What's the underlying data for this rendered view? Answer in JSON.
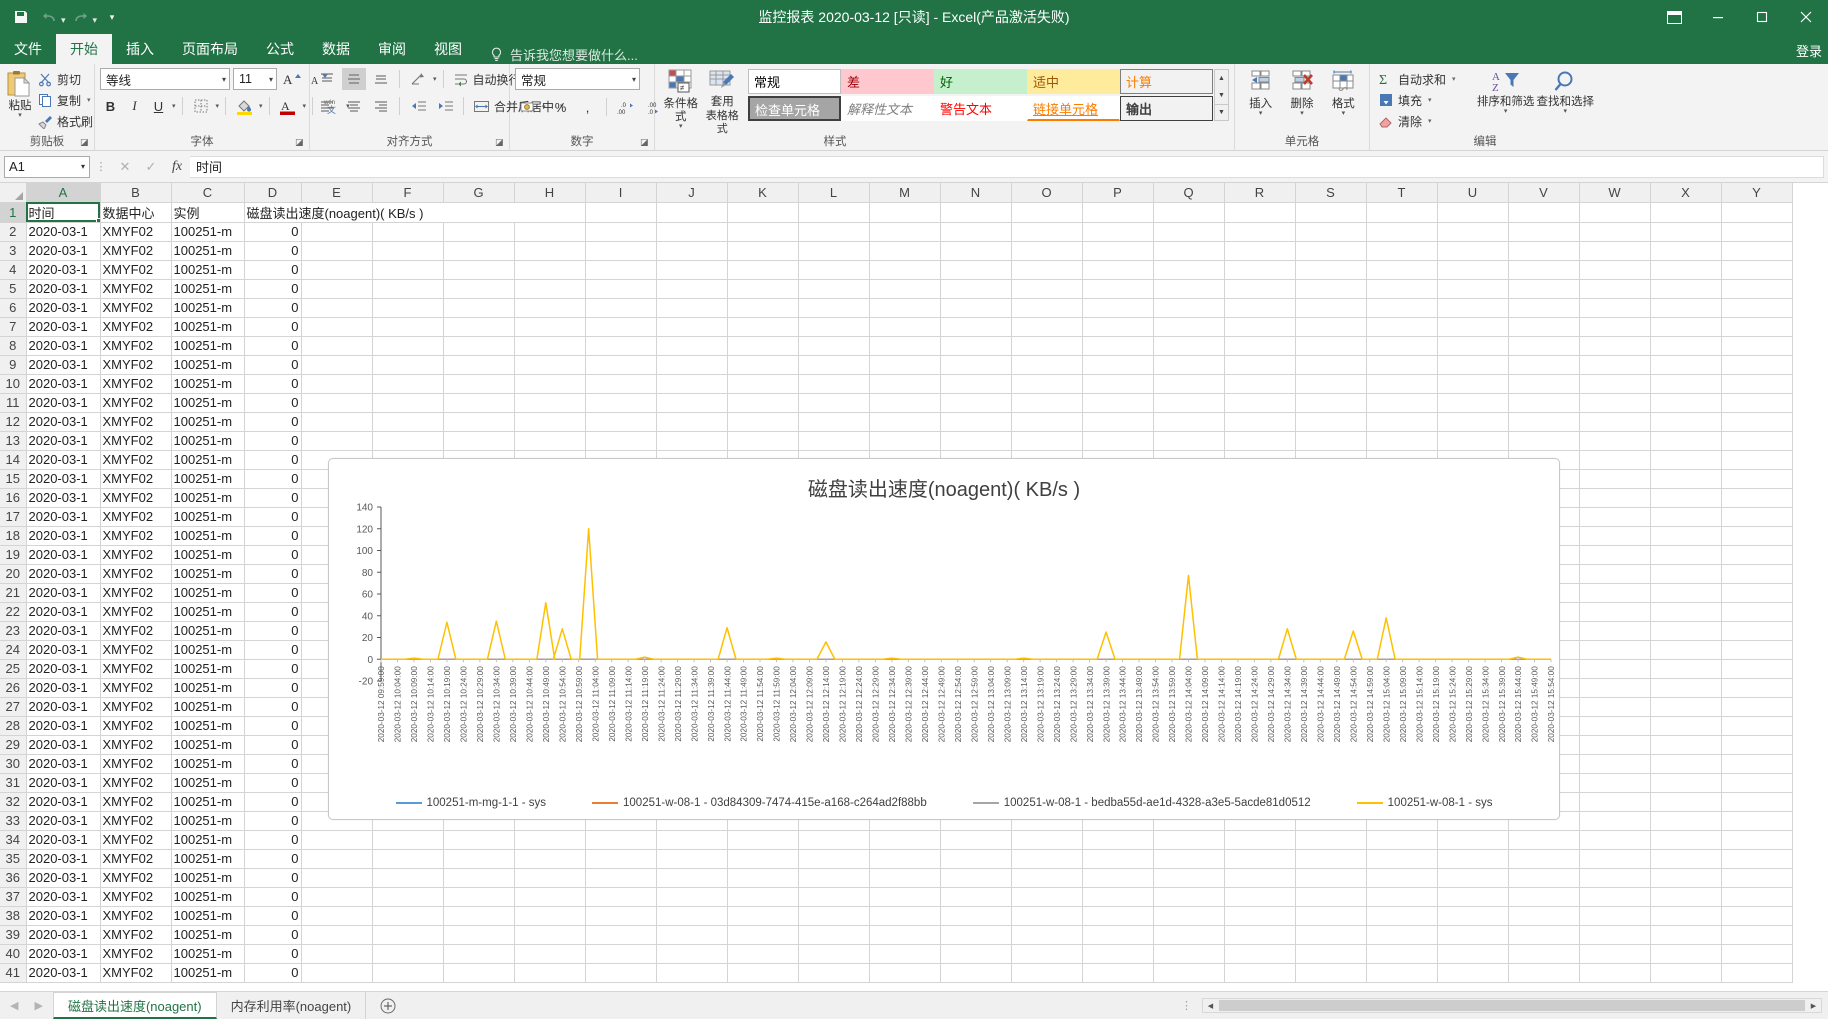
{
  "window": {
    "title": "监控报表 2020-03-12  [只读] - Excel(产品激活失败)",
    "signin": "登录",
    "minimize": "minimize",
    "restore": "restore",
    "close": "close",
    "ribbon_display_options": "ribbon-display-options"
  },
  "quick_access": {
    "save": "保存",
    "undo": "撤销",
    "redo": "恢复",
    "customize": "自定义快速访问工具栏"
  },
  "tabs": [
    {
      "label": "文件",
      "active": false
    },
    {
      "label": "开始",
      "active": true
    },
    {
      "label": "插入",
      "active": false
    },
    {
      "label": "页面布局",
      "active": false
    },
    {
      "label": "公式",
      "active": false
    },
    {
      "label": "数据",
      "active": false
    },
    {
      "label": "审阅",
      "active": false
    },
    {
      "label": "视图",
      "active": false
    }
  ],
  "tellme": "告诉我您想要做什么...",
  "ribbon": {
    "clipboard": {
      "label": "剪贴板",
      "paste": "粘贴",
      "cut": "剪切",
      "copy": "复制",
      "format_painter": "格式刷"
    },
    "font": {
      "label": "字体",
      "font_name": "等线",
      "font_size": "11",
      "grow": "A",
      "shrink": "A",
      "bold": "B",
      "italic": "I",
      "underline": "U",
      "border": "borders",
      "fill": "fill-color",
      "font_color": "font-color",
      "phonetic": "拼音"
    },
    "alignment": {
      "label": "对齐方式",
      "wrap_text": "自动换行",
      "merge_center": "合并后居中",
      "orientation": "方向",
      "align_left": "左对齐",
      "align_center": "居中",
      "align_right": "右对齐",
      "top": "顶端对齐",
      "middle": "垂直居中",
      "bottom": "底端对齐",
      "decrease_indent": "减少缩进量",
      "increase_indent": "增加缩进量"
    },
    "number": {
      "label": "数字",
      "format": "常规",
      "currency": "会计数字格式",
      "percent": "%",
      "comma": ",",
      "increase_decimal": "增加小数位数",
      "decrease_decimal": "减少小数位数"
    },
    "styles": {
      "label": "样式",
      "conditional": "条件格式",
      "table_format_l1": "套用",
      "table_format_l2": "表格格式",
      "cells": [
        {
          "text": "常规",
          "fg": "#000000",
          "bg": "#ffffff",
          "border": "#d6d6d6",
          "style": "normal",
          "selected": false
        },
        {
          "text": "差",
          "fg": "#9c0006",
          "bg": "#ffc7ce",
          "border": "#ffc7ce",
          "style": "normal",
          "selected": false
        },
        {
          "text": "好",
          "fg": "#006100",
          "bg": "#c6efce",
          "border": "#c6efce",
          "style": "normal",
          "selected": false
        },
        {
          "text": "适中",
          "fg": "#9c5700",
          "bg": "#ffeb9c",
          "border": "#ffeb9c",
          "style": "normal",
          "selected": false
        },
        {
          "text": "计算",
          "fg": "#fa7d00",
          "bg": "#f2f2f2",
          "border": "#7f7f7f",
          "style": "normal",
          "selected": false
        },
        {
          "text": "检查单元格",
          "fg": "#ffffff",
          "bg": "#a5a5a5",
          "border": "#3f3f3f",
          "style": "normal",
          "selected": true
        },
        {
          "text": "解释性文本",
          "fg": "#7f7f7f",
          "bg": "#ffffff",
          "border": "#ffffff",
          "style": "italic",
          "selected": false
        },
        {
          "text": "警告文本",
          "fg": "#ff0000",
          "bg": "#ffffff",
          "border": "#ffffff",
          "style": "normal",
          "selected": false
        },
        {
          "text": "链接单元格",
          "fg": "#fa7d00",
          "bg": "#ffffff",
          "border": "#ffffff",
          "style": "underline",
          "selected": false
        },
        {
          "text": "输出",
          "fg": "#3f3f3f",
          "bg": "#f2f2f2",
          "border": "#3f3f3f",
          "style": "bold",
          "selected": false
        }
      ],
      "scroll_up": "▲",
      "scroll_down": "▼",
      "scroll_more": "▼"
    },
    "cells": {
      "label": "单元格",
      "insert": "插入",
      "delete": "删除",
      "format": "格式"
    },
    "editing": {
      "label": "编辑",
      "autosum": "自动求和",
      "fill": "填充",
      "clear": "清除",
      "sort_filter": "排序和筛选",
      "find_select": "查找和选择"
    }
  },
  "formula_bar": {
    "name_box": "A1",
    "cancel": "✕",
    "enter": "✓",
    "insert_function": "fx",
    "content": "时间"
  },
  "grid": {
    "columns": [
      "A",
      "B",
      "C",
      "D",
      "E",
      "F",
      "G",
      "H",
      "I",
      "J",
      "K",
      "L",
      "M",
      "N",
      "O",
      "P",
      "Q",
      "R",
      "S",
      "T",
      "U",
      "V",
      "W",
      "X",
      "Y"
    ],
    "selected_column": "A",
    "selected_row": 1,
    "header_row": [
      "时间",
      "数据中心",
      "实例",
      "磁盘读出速度(noagent)( KB/s )"
    ],
    "data_rows": [
      [
        "2020-03-1",
        "XMYF02",
        "100251-m",
        "0"
      ],
      [
        "2020-03-1",
        "XMYF02",
        "100251-m",
        "0"
      ],
      [
        "2020-03-1",
        "XMYF02",
        "100251-m",
        "0"
      ],
      [
        "2020-03-1",
        "XMYF02",
        "100251-m",
        "0"
      ],
      [
        "2020-03-1",
        "XMYF02",
        "100251-m",
        "0"
      ],
      [
        "2020-03-1",
        "XMYF02",
        "100251-m",
        "0"
      ],
      [
        "2020-03-1",
        "XMYF02",
        "100251-m",
        "0"
      ],
      [
        "2020-03-1",
        "XMYF02",
        "100251-m",
        "0"
      ],
      [
        "2020-03-1",
        "XMYF02",
        "100251-m",
        "0"
      ],
      [
        "2020-03-1",
        "XMYF02",
        "100251-m",
        "0"
      ],
      [
        "2020-03-1",
        "XMYF02",
        "100251-m",
        "0"
      ],
      [
        "2020-03-1",
        "XMYF02",
        "100251-m",
        "0"
      ],
      [
        "2020-03-1",
        "XMYF02",
        "100251-m",
        "0"
      ],
      [
        "2020-03-1",
        "XMYF02",
        "100251-m",
        "0"
      ],
      [
        "2020-03-1",
        "XMYF02",
        "100251-m",
        "0"
      ],
      [
        "2020-03-1",
        "XMYF02",
        "100251-m",
        "0"
      ],
      [
        "2020-03-1",
        "XMYF02",
        "100251-m",
        "0"
      ],
      [
        "2020-03-1",
        "XMYF02",
        "100251-m",
        "0"
      ],
      [
        "2020-03-1",
        "XMYF02",
        "100251-m",
        "0"
      ],
      [
        "2020-03-1",
        "XMYF02",
        "100251-m",
        "0"
      ],
      [
        "2020-03-1",
        "XMYF02",
        "100251-m",
        "0"
      ],
      [
        "2020-03-1",
        "XMYF02",
        "100251-m",
        "0"
      ],
      [
        "2020-03-1",
        "XMYF02",
        "100251-m",
        "0"
      ],
      [
        "2020-03-1",
        "XMYF02",
        "100251-m",
        "0"
      ],
      [
        "2020-03-1",
        "XMYF02",
        "100251-m",
        "0"
      ],
      [
        "2020-03-1",
        "XMYF02",
        "100251-m",
        "0"
      ],
      [
        "2020-03-1",
        "XMYF02",
        "100251-m",
        "0"
      ],
      [
        "2020-03-1",
        "XMYF02",
        "100251-m",
        "0"
      ],
      [
        "2020-03-1",
        "XMYF02",
        "100251-m",
        "0"
      ],
      [
        "2020-03-1",
        "XMYF02",
        "100251-m",
        "0"
      ],
      [
        "2020-03-1",
        "XMYF02",
        "100251-m",
        "0"
      ],
      [
        "2020-03-1",
        "XMYF02",
        "100251-m",
        "0"
      ],
      [
        "2020-03-1",
        "XMYF02",
        "100251-m",
        "0"
      ],
      [
        "2020-03-1",
        "XMYF02",
        "100251-m",
        "0"
      ],
      [
        "2020-03-1",
        "XMYF02",
        "100251-m",
        "0"
      ],
      [
        "2020-03-1",
        "XMYF02",
        "100251-m",
        "0"
      ],
      [
        "2020-03-1",
        "XMYF02",
        "100251-m",
        "0"
      ],
      [
        "2020-03-1",
        "XMYF02",
        "100251-m",
        "0"
      ],
      [
        "2020-03-1",
        "XMYF02",
        "100251-m",
        "0"
      ],
      [
        "2020-03-1",
        "XMYF02",
        "100251-m",
        "0"
      ]
    ]
  },
  "sheet_tabs": {
    "prev": "◀",
    "next": "▶",
    "tabs": [
      {
        "label": "磁盘读出速度(noagent)",
        "active": true
      },
      {
        "label": "内存利用率(noagent)",
        "active": false
      }
    ],
    "add": "+"
  },
  "chart_data": {
    "type": "line",
    "title": "磁盘读出速度(noagent)( KB/s )",
    "xlabel": "",
    "ylabel": "",
    "ylim": [
      -20,
      140
    ],
    "yticks": [
      140,
      120,
      100,
      80,
      60,
      40,
      20,
      0,
      -20
    ],
    "grid": false,
    "legend_position": "bottom",
    "legend": [
      {
        "name": "100251-m-mg-1-1 - sys",
        "color": "#5b9bd5"
      },
      {
        "name": "100251-w-08-1 - 03d84309-7474-415e-a168-c264ad2f88bb",
        "color": "#ed7d31"
      },
      {
        "name": "100251-w-08-1 - bedba55d-ae1d-4328-a3e5-5acde81d0512",
        "color": "#a5a5a5"
      },
      {
        "name": "100251-w-08-1 - sys",
        "color": "#ffc000"
      }
    ],
    "xticks": [
      "2020-03-12 09:59:00",
      "2020-03-12 10:04:00",
      "2020-03-12 10:09:00",
      "2020-03-12 10:14:00",
      "2020-03-12 10:19:00",
      "2020-03-12 10:24:00",
      "2020-03-12 10:29:00",
      "2020-03-12 10:34:00",
      "2020-03-12 10:39:00",
      "2020-03-12 10:44:00",
      "2020-03-12 10:49:00",
      "2020-03-12 10:54:00",
      "2020-03-12 10:59:00",
      "2020-03-12 11:04:00",
      "2020-03-12 11:09:00",
      "2020-03-12 11:14:00",
      "2020-03-12 11:19:00",
      "2020-03-12 11:24:00",
      "2020-03-12 11:29:00",
      "2020-03-12 11:34:00",
      "2020-03-12 11:39:00",
      "2020-03-12 11:44:00",
      "2020-03-12 11:49:00",
      "2020-03-12 11:54:00",
      "2020-03-12 11:59:00",
      "2020-03-12 12:04:00",
      "2020-03-12 12:09:00",
      "2020-03-12 12:14:00",
      "2020-03-12 12:19:00",
      "2020-03-12 12:24:00",
      "2020-03-12 12:29:00",
      "2020-03-12 12:34:00",
      "2020-03-12 12:39:00",
      "2020-03-12 12:44:00",
      "2020-03-12 12:49:00",
      "2020-03-12 12:54:00",
      "2020-03-12 12:59:00",
      "2020-03-12 13:04:00",
      "2020-03-12 13:09:00",
      "2020-03-12 13:14:00",
      "2020-03-12 13:19:00",
      "2020-03-12 13:24:00",
      "2020-03-12 13:29:00",
      "2020-03-12 13:34:00",
      "2020-03-12 13:39:00",
      "2020-03-12 13:44:00",
      "2020-03-12 13:49:00",
      "2020-03-12 13:54:00",
      "2020-03-12 13:59:00",
      "2020-03-12 14:04:00",
      "2020-03-12 14:09:00",
      "2020-03-12 14:14:00",
      "2020-03-12 14:19:00",
      "2020-03-12 14:24:00",
      "2020-03-12 14:29:00",
      "2020-03-12 14:34:00",
      "2020-03-12 14:39:00",
      "2020-03-12 14:44:00",
      "2020-03-12 14:49:00",
      "2020-03-12 14:54:00",
      "2020-03-12 14:59:00",
      "2020-03-12 15:04:00",
      "2020-03-12 15:09:00",
      "2020-03-12 15:14:00",
      "2020-03-12 15:19:00",
      "2020-03-12 15:24:00",
      "2020-03-12 15:29:00",
      "2020-03-12 15:34:00",
      "2020-03-12 15:39:00",
      "2020-03-12 15:44:00",
      "2020-03-12 15:49:00",
      "2020-03-12 15:54:00"
    ],
    "series": [
      {
        "name": "100251-m-mg-1-1 - sys",
        "color": "#5b9bd5",
        "values": [
          0,
          0,
          0,
          0,
          0,
          0,
          0,
          0,
          0,
          0,
          0,
          0,
          0,
          0,
          0,
          0,
          0,
          0,
          0,
          0,
          0,
          0,
          0,
          0,
          0,
          0,
          0,
          0,
          0,
          0,
          0,
          0,
          0,
          0,
          0,
          0,
          0,
          0,
          0,
          0,
          0,
          0,
          0,
          0,
          0,
          0,
          0,
          0,
          0,
          0,
          0,
          0,
          0,
          0,
          0,
          0,
          0,
          0,
          0,
          0,
          0,
          0,
          0,
          0,
          0,
          0,
          0,
          0,
          0,
          0,
          0,
          0
        ]
      },
      {
        "name": "100251-w-08-1 - 03d84309-7474-415e-a168-c264ad2f88bb",
        "color": "#ed7d31",
        "values": [
          0,
          0,
          0,
          0,
          0,
          0,
          0,
          0,
          0,
          0,
          0,
          0,
          0,
          0,
          0,
          0,
          0,
          0,
          0,
          0,
          0,
          0,
          0,
          0,
          0,
          0,
          0,
          0,
          0,
          0,
          0,
          0,
          0,
          0,
          0,
          0,
          0,
          0,
          0,
          0,
          0,
          0,
          0,
          0,
          0,
          0,
          0,
          0,
          0,
          0,
          0,
          0,
          0,
          0,
          0,
          0,
          0,
          0,
          0,
          0,
          0,
          0,
          0,
          0,
          0,
          0,
          0,
          0,
          0,
          0,
          0,
          0
        ]
      },
      {
        "name": "100251-w-08-1 - bedba55d-ae1d-4328-a3e5-5acde81d0512",
        "color": "#a5a5a5",
        "values": [
          0,
          0,
          0,
          0,
          0,
          0,
          0,
          0,
          0,
          0,
          0,
          0,
          0,
          0,
          0,
          0,
          0,
          0,
          0,
          0,
          0,
          0,
          0,
          0,
          0,
          0,
          0,
          0,
          0,
          0,
          0,
          0,
          0,
          0,
          0,
          0,
          0,
          0,
          0,
          0,
          0,
          0,
          0,
          0,
          0,
          0,
          0,
          0,
          0,
          0,
          0,
          0,
          0,
          0,
          0,
          0,
          0,
          0,
          0,
          0,
          0,
          0,
          0,
          0,
          0,
          0,
          0,
          0,
          0,
          0,
          0,
          0
        ]
      },
      {
        "name": "100251-w-08-1 - sys",
        "color": "#ffc000",
        "values": [
          0,
          0,
          1,
          0,
          34,
          0,
          0,
          35,
          0,
          0,
          52,
          0,
          120,
          0,
          0,
          0,
          2,
          0,
          0,
          0,
          0,
          29,
          0,
          0,
          1,
          0,
          0,
          16,
          0,
          0,
          0,
          1,
          0,
          0,
          0,
          0,
          0,
          0,
          0,
          1,
          0,
          0,
          0,
          0,
          25,
          0,
          0,
          0,
          0,
          77,
          0,
          0,
          0,
          0,
          0,
          28,
          0,
          0,
          0,
          26,
          0,
          38,
          0,
          0,
          0,
          0,
          0,
          0,
          0,
          2,
          0,
          0,
          0,
          0,
          0,
          0,
          0,
          0,
          0,
          0,
          0,
          0,
          0,
          0,
          0,
          0,
          0,
          0,
          0,
          0,
          0,
          0,
          0,
          0,
          0,
          0,
          0,
          0,
          0,
          0,
          0,
          0,
          0,
          0,
          0,
          0,
          0,
          0,
          0,
          0,
          0,
          0,
          0,
          0,
          0,
          0,
          0,
          0,
          0,
          0,
          0,
          0,
          0,
          0,
          0,
          0,
          0,
          0,
          0,
          0,
          0,
          0,
          0,
          0,
          0,
          0,
          0,
          0,
          0,
          0,
          0,
          0,
          0,
          0,
          0
        ]
      }
    ],
    "spikes": [
      {
        "x": 2,
        "y": 1
      },
      {
        "x": 4,
        "y": 34
      },
      {
        "x": 7,
        "y": 35
      },
      {
        "x": 10,
        "y": 52
      },
      {
        "x": 11,
        "y": 28
      },
      {
        "x": 12.6,
        "y": 120
      },
      {
        "x": 16,
        "y": 2
      },
      {
        "x": 21,
        "y": 29
      },
      {
        "x": 24,
        "y": 1
      },
      {
        "x": 27,
        "y": 16
      },
      {
        "x": 31,
        "y": 1
      },
      {
        "x": 39,
        "y": 1
      },
      {
        "x": 44,
        "y": 25
      },
      {
        "x": 49,
        "y": 77
      },
      {
        "x": 55,
        "y": 28
      },
      {
        "x": 59,
        "y": 26
      },
      {
        "x": 61,
        "y": 38
      },
      {
        "x": 69,
        "y": 2
      }
    ]
  }
}
